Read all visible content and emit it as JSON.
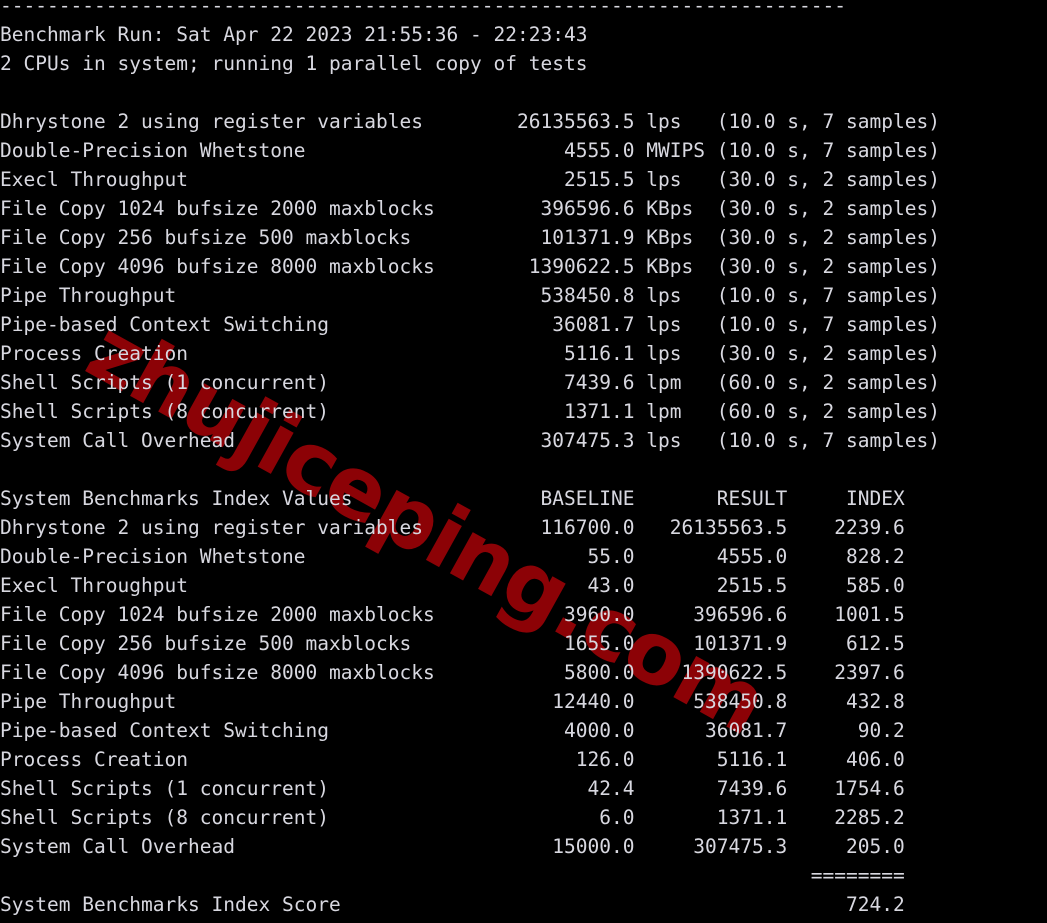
{
  "terminal": {
    "window_title": "UnixBench benchmark output",
    "background_color": "#000000",
    "foreground_color": "#d8d8e0",
    "font": "monospace",
    "columns": 80
  },
  "watermark": {
    "text": "zhujiceping.com",
    "color": "#8c0206",
    "rotation_degrees": 29
  },
  "report": {
    "rule": "------------------------------------------------------------------------",
    "run_header": "Benchmark Run: Sat Apr 22 2023 21:55:36 - 22:23:43",
    "cpu_header": "2 CPUs in system; running 1 parallel copy of tests",
    "raw_results_label": "",
    "raw_results": [
      {
        "name": "Dhrystone 2 using register variables",
        "value": "26135563.5",
        "unit": "lps",
        "duration": "10.0 s",
        "samples": "7 samples"
      },
      {
        "name": "Double-Precision Whetstone",
        "value": "4555.0",
        "unit": "MWIPS",
        "duration": "10.0 s",
        "samples": "7 samples"
      },
      {
        "name": "Execl Throughput",
        "value": "2515.5",
        "unit": "lps",
        "duration": "30.0 s",
        "samples": "2 samples"
      },
      {
        "name": "File Copy 1024 bufsize 2000 maxblocks",
        "value": "396596.6",
        "unit": "KBps",
        "duration": "30.0 s",
        "samples": "2 samples"
      },
      {
        "name": "File Copy 256 bufsize 500 maxblocks",
        "value": "101371.9",
        "unit": "KBps",
        "duration": "30.0 s",
        "samples": "2 samples"
      },
      {
        "name": "File Copy 4096 bufsize 8000 maxblocks",
        "value": "1390622.5",
        "unit": "KBps",
        "duration": "30.0 s",
        "samples": "2 samples"
      },
      {
        "name": "Pipe Throughput",
        "value": "538450.8",
        "unit": "lps",
        "duration": "10.0 s",
        "samples": "7 samples"
      },
      {
        "name": "Pipe-based Context Switching",
        "value": "36081.7",
        "unit": "lps",
        "duration": "10.0 s",
        "samples": "7 samples"
      },
      {
        "name": "Process Creation",
        "value": "5116.1",
        "unit": "lps",
        "duration": "30.0 s",
        "samples": "2 samples"
      },
      {
        "name": "Shell Scripts (1 concurrent)",
        "value": "7439.6",
        "unit": "lpm",
        "duration": "60.0 s",
        "samples": "2 samples"
      },
      {
        "name": "Shell Scripts (8 concurrent)",
        "value": "1371.1",
        "unit": "lpm",
        "duration": "60.0 s",
        "samples": "2 samples"
      },
      {
        "name": "System Call Overhead",
        "value": "307475.3",
        "unit": "lps",
        "duration": "10.0 s",
        "samples": "7 samples"
      }
    ],
    "index_table": {
      "title": "System Benchmarks Index Values",
      "columns": [
        "BASELINE",
        "RESULT",
        "INDEX"
      ],
      "rows": [
        {
          "name": "Dhrystone 2 using register variables",
          "baseline": "116700.0",
          "result": "26135563.5",
          "index": "2239.6"
        },
        {
          "name": "Double-Precision Whetstone",
          "baseline": "55.0",
          "result": "4555.0",
          "index": "828.2"
        },
        {
          "name": "Execl Throughput",
          "baseline": "43.0",
          "result": "2515.5",
          "index": "585.0"
        },
        {
          "name": "File Copy 1024 bufsize 2000 maxblocks",
          "baseline": "3960.0",
          "result": "396596.6",
          "index": "1001.5"
        },
        {
          "name": "File Copy 256 bufsize 500 maxblocks",
          "baseline": "1655.0",
          "result": "101371.9",
          "index": "612.5"
        },
        {
          "name": "File Copy 4096 bufsize 8000 maxblocks",
          "baseline": "5800.0",
          "result": "1390622.5",
          "index": "2397.6"
        },
        {
          "name": "Pipe Throughput",
          "baseline": "12440.0",
          "result": "538450.8",
          "index": "432.8"
        },
        {
          "name": "Pipe-based Context Switching",
          "baseline": "4000.0",
          "result": "36081.7",
          "index": "90.2"
        },
        {
          "name": "Process Creation",
          "baseline": "126.0",
          "result": "5116.1",
          "index": "406.0"
        },
        {
          "name": "Shell Scripts (1 concurrent)",
          "baseline": "42.4",
          "result": "7439.6",
          "index": "1754.6"
        },
        {
          "name": "Shell Scripts (8 concurrent)",
          "baseline": "6.0",
          "result": "1371.1",
          "index": "2285.2"
        },
        {
          "name": "System Call Overhead",
          "baseline": "15000.0",
          "result": "307475.3",
          "index": "205.0"
        }
      ],
      "separator": "========",
      "score_label": "System Benchmarks Index Score",
      "score_value": "724.2"
    }
  }
}
